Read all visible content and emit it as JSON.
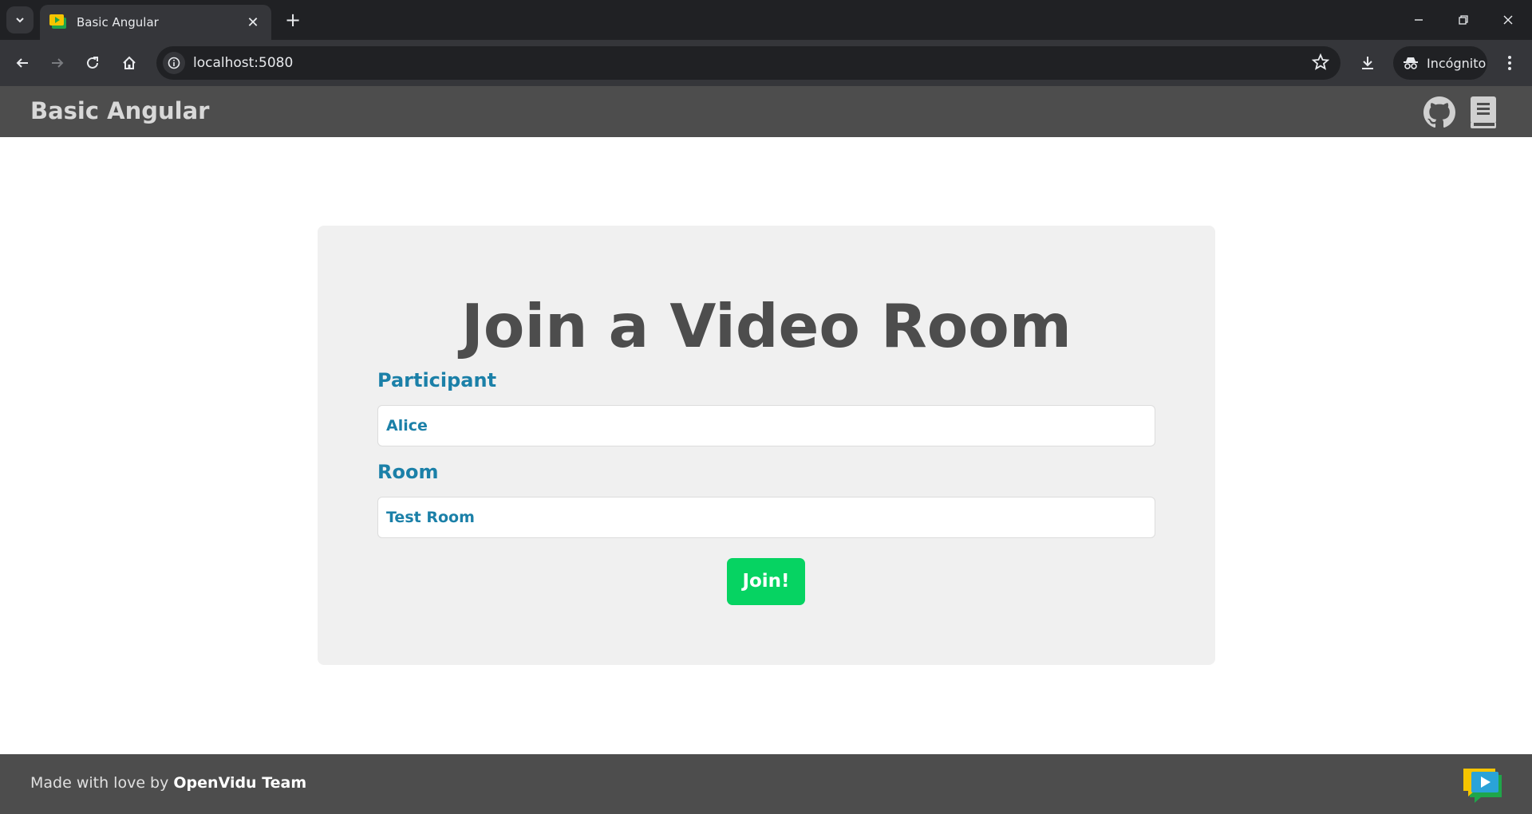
{
  "browser": {
    "tab_title": "Basic Angular",
    "url": "localhost:5080",
    "profile_label": "Incógnito"
  },
  "header": {
    "title": "Basic Angular"
  },
  "form": {
    "heading": "Join a Video Room",
    "participant_label": "Participant",
    "participant_value": "Alice",
    "room_label": "Room",
    "room_value": "Test Room",
    "join_label": "Join!"
  },
  "footer": {
    "prefix": "Made with love by ",
    "team": "OpenVidu Team"
  },
  "colors": {
    "accent": "#1b80a8",
    "join_button": "#06d362",
    "header_bg": "#4d4d4d",
    "card_bg": "#f0f0f0"
  }
}
